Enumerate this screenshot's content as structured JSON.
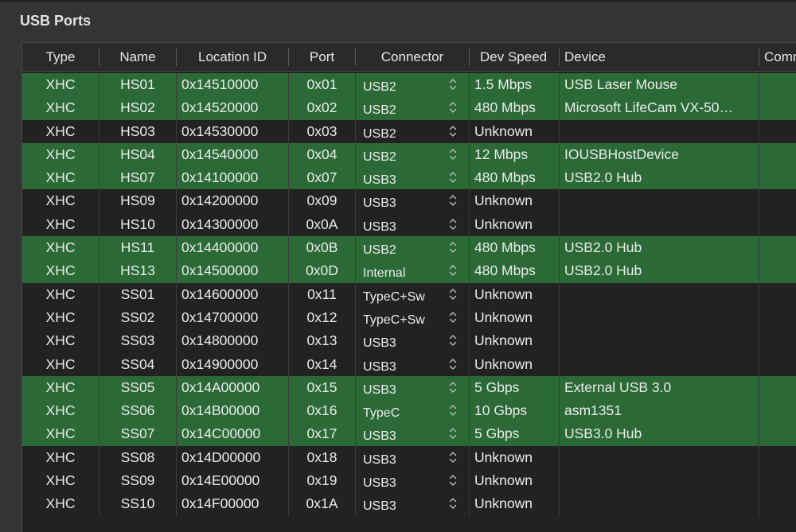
{
  "title": "USB Ports",
  "columns": [
    "Type",
    "Name",
    "Location ID",
    "Port",
    "Connector",
    "Dev Speed",
    "Device",
    "Comm"
  ],
  "rows": [
    {
      "type": "XHC",
      "name": "HS01",
      "location": "0x14510000",
      "port": "0x01",
      "connector": "USB2",
      "speed": "1.5 Mbps",
      "device": "USB Laser Mouse",
      "active": true
    },
    {
      "type": "XHC",
      "name": "HS02",
      "location": "0x14520000",
      "port": "0x02",
      "connector": "USB2",
      "speed": "480 Mbps",
      "device": "Microsoft LifeCam VX-50…",
      "active": true
    },
    {
      "type": "XHC",
      "name": "HS03",
      "location": "0x14530000",
      "port": "0x03",
      "connector": "USB2",
      "speed": "Unknown",
      "device": "",
      "active": false
    },
    {
      "type": "XHC",
      "name": "HS04",
      "location": "0x14540000",
      "port": "0x04",
      "connector": "USB2",
      "speed": "12 Mbps",
      "device": "IOUSBHostDevice",
      "active": true
    },
    {
      "type": "XHC",
      "name": "HS07",
      "location": "0x14100000",
      "port": "0x07",
      "connector": "USB3",
      "speed": "480 Mbps",
      "device": "USB2.0 Hub",
      "active": true
    },
    {
      "type": "XHC",
      "name": "HS09",
      "location": "0x14200000",
      "port": "0x09",
      "connector": "USB3",
      "speed": "Unknown",
      "device": "",
      "active": false
    },
    {
      "type": "XHC",
      "name": "HS10",
      "location": "0x14300000",
      "port": "0x0A",
      "connector": "USB3",
      "speed": "Unknown",
      "device": "",
      "active": false
    },
    {
      "type": "XHC",
      "name": "HS11",
      "location": "0x14400000",
      "port": "0x0B",
      "connector": "USB2",
      "speed": "480 Mbps",
      "device": "USB2.0 Hub",
      "active": true
    },
    {
      "type": "XHC",
      "name": "HS13",
      "location": "0x14500000",
      "port": "0x0D",
      "connector": "Internal",
      "speed": "480 Mbps",
      "device": "USB2.0 Hub",
      "active": true
    },
    {
      "type": "XHC",
      "name": "SS01",
      "location": "0x14600000",
      "port": "0x11",
      "connector": "TypeC+Sw",
      "speed": "Unknown",
      "device": "",
      "active": false
    },
    {
      "type": "XHC",
      "name": "SS02",
      "location": "0x14700000",
      "port": "0x12",
      "connector": "TypeC+Sw",
      "speed": "Unknown",
      "device": "",
      "active": false
    },
    {
      "type": "XHC",
      "name": "SS03",
      "location": "0x14800000",
      "port": "0x13",
      "connector": "USB3",
      "speed": "Unknown",
      "device": "",
      "active": false
    },
    {
      "type": "XHC",
      "name": "SS04",
      "location": "0x14900000",
      "port": "0x14",
      "connector": "USB3",
      "speed": "Unknown",
      "device": "",
      "active": false
    },
    {
      "type": "XHC",
      "name": "SS05",
      "location": "0x14A00000",
      "port": "0x15",
      "connector": "USB3",
      "speed": "5 Gbps",
      "device": "External USB 3.0",
      "active": true
    },
    {
      "type": "XHC",
      "name": "SS06",
      "location": "0x14B00000",
      "port": "0x16",
      "connector": "TypeC",
      "speed": "10 Gbps",
      "device": "asm1351",
      "active": true
    },
    {
      "type": "XHC",
      "name": "SS07",
      "location": "0x14C00000",
      "port": "0x17",
      "connector": "USB3",
      "speed": "5 Gbps",
      "device": "USB3.0 Hub",
      "active": true
    },
    {
      "type": "XHC",
      "name": "SS08",
      "location": "0x14D00000",
      "port": "0x18",
      "connector": "USB3",
      "speed": "Unknown",
      "device": "",
      "active": false
    },
    {
      "type": "XHC",
      "name": "SS09",
      "location": "0x14E00000",
      "port": "0x19",
      "connector": "USB3",
      "speed": "Unknown",
      "device": "",
      "active": false
    },
    {
      "type": "XHC",
      "name": "SS10",
      "location": "0x14F00000",
      "port": "0x1A",
      "connector": "USB3",
      "speed": "Unknown",
      "device": "",
      "active": false
    }
  ],
  "colors": {
    "active_row": "#2b6a36",
    "inactive_row": "#222222",
    "window_bg": "#343434"
  },
  "icons": {
    "connector_picker": "up-down-chevron-icon"
  }
}
